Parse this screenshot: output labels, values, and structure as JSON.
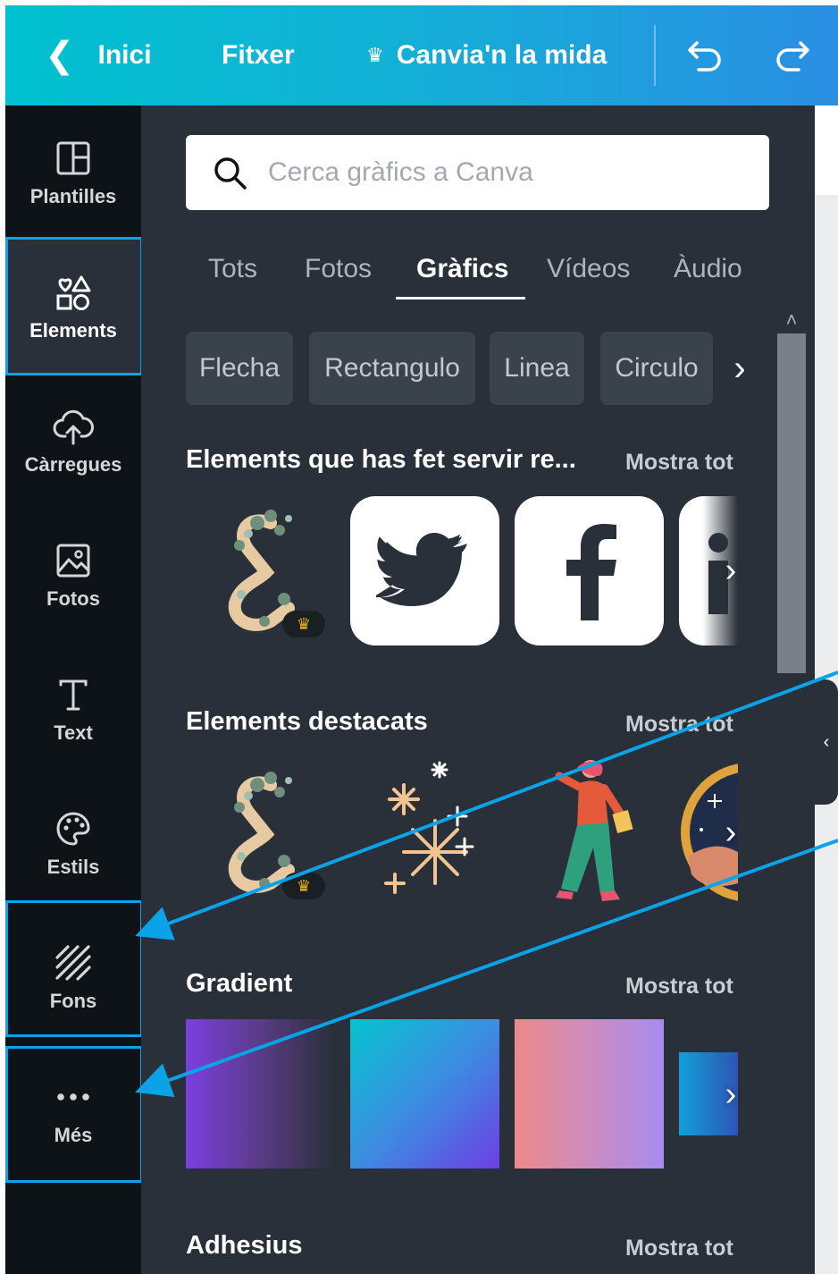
{
  "topbar": {
    "back_label": "Inici",
    "file_label": "Fitxer",
    "resize_label": "Canvia'n la mida"
  },
  "rail": {
    "items": [
      {
        "label": "Plantilles",
        "icon": "layout-icon"
      },
      {
        "label": "Elements",
        "icon": "shapes-icon"
      },
      {
        "label": "Càrregues",
        "icon": "cloud-upload-icon"
      },
      {
        "label": "Fotos",
        "icon": "image-icon"
      },
      {
        "label": "Text",
        "icon": "text-icon"
      },
      {
        "label": "Estils",
        "icon": "palette-icon"
      },
      {
        "label": "Fons",
        "icon": "hatch-icon"
      },
      {
        "label": "Més",
        "icon": "more-icon"
      }
    ]
  },
  "search": {
    "placeholder": "Cerca gràfics a Canva"
  },
  "tabs": [
    "Tots",
    "Fotos",
    "Gràfics",
    "Vídeos",
    "Àudio"
  ],
  "chips": [
    "Flecha",
    "Rectangulo",
    "Linea",
    "Circulo"
  ],
  "sections": {
    "recent": {
      "title": "Elements que has fet servir re...",
      "show_all": "Mostra tot"
    },
    "featured": {
      "title": "Elements destacats",
      "show_all": "Mostra tot"
    },
    "gradient": {
      "title": "Gradient",
      "show_all": "Mostra tot"
    },
    "stickers": {
      "title": "Adhesius",
      "show_all": "Mostra tot"
    }
  },
  "colors": {
    "highlight": "#0aa3e8",
    "panel": "#293039",
    "rail": "#0e1318"
  }
}
